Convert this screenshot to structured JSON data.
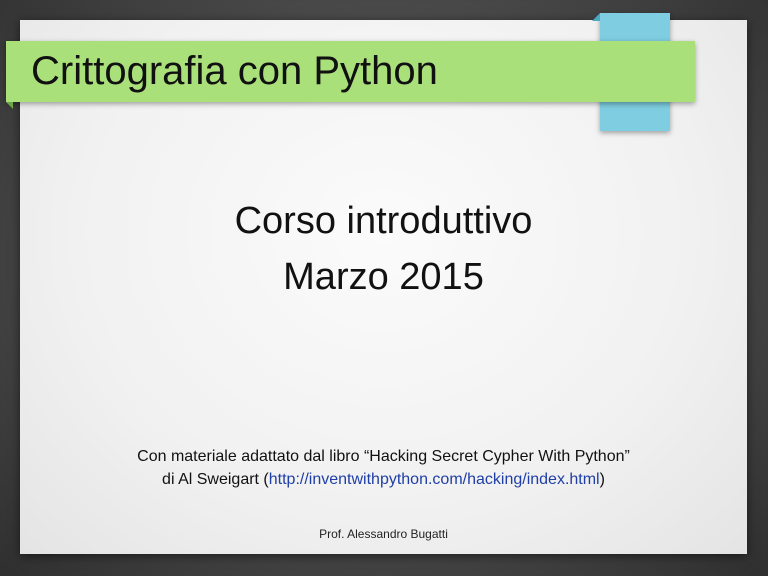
{
  "slide": {
    "title": "Crittografia con Python",
    "subtitle_line1": "Corso introduttivo",
    "subtitle_line2": "Marzo 2015",
    "credit_line1": "Con materiale adattato dal libro “Hacking Secret Cypher With Python”",
    "credit_line2_prefix": "di Al Sweigart (",
    "credit_link": "http://inventwithpython.com/hacking/index.html",
    "credit_line2_suffix": ")",
    "footer": "Prof. Alessandro Bugatti"
  },
  "colors": {
    "title_bar": "#a9e07a",
    "accent_tab": "#7ecde0",
    "link": "#1f3fa6"
  }
}
